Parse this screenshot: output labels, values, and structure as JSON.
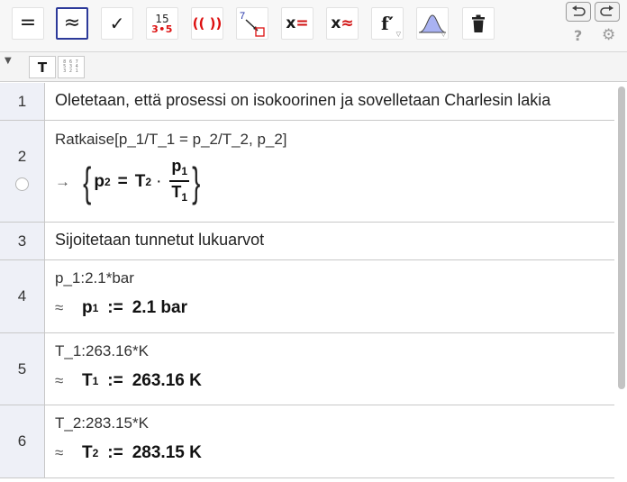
{
  "toolbar": {
    "tools": [
      {
        "name": "evaluate",
        "label": "="
      },
      {
        "name": "numeric",
        "label": "≈"
      },
      {
        "name": "keep-input",
        "label": "✓"
      },
      {
        "name": "factor",
        "top": "15",
        "bottom": "3•5"
      },
      {
        "name": "expand",
        "label": "(( ))"
      },
      {
        "name": "substitute",
        "label": "7"
      },
      {
        "name": "solve",
        "label": "x="
      },
      {
        "name": "solve-numerically",
        "label": "x≈"
      },
      {
        "name": "derivative",
        "label": "f′"
      },
      {
        "name": "probability-calculator",
        "label": ""
      },
      {
        "name": "delete",
        "label": ""
      }
    ],
    "help_label": "?",
    "colors": {
      "active_border": "#2d3a9a",
      "red": "#d11111",
      "blue": "#1f2fa6"
    }
  },
  "stylebar": {
    "text_button": "T",
    "table_button": "867\n534\n321"
  },
  "cas": {
    "rows": [
      {
        "num": "1",
        "text": "Oletetaan, että prosessi on isokoorinen ja sovelletaan Charlesin lakia"
      },
      {
        "num": "2",
        "input": "Ratkaise[p_1/T_1 = p_2/T_2, p_2]",
        "marker": "→",
        "brace_open": "{",
        "brace_close": "}",
        "lhs": "p",
        "lhs_sub": "2",
        "eq": "=",
        "t": "T",
        "t_sub": "2",
        "dot": "·",
        "num_var": "p",
        "num_sub": "1",
        "den_var": "T",
        "den_sub": "1"
      },
      {
        "num": "3",
        "text": "Sijoitetaan tunnetut lukuarvot"
      },
      {
        "num": "4",
        "input": "p_1:2.1*bar",
        "marker": "≈",
        "var": "p",
        "sub": "1",
        "assign": ":=",
        "value": "2.1 bar"
      },
      {
        "num": "5",
        "input": "T_1:263.16*K",
        "marker": "≈",
        "var": "T",
        "sub": "1",
        "assign": ":=",
        "value": "263.16 K"
      },
      {
        "num": "6",
        "input": "T_2:283.15*K",
        "marker": "≈",
        "var": "T",
        "sub": "2",
        "assign": ":=",
        "value": "283.15 K"
      }
    ]
  }
}
